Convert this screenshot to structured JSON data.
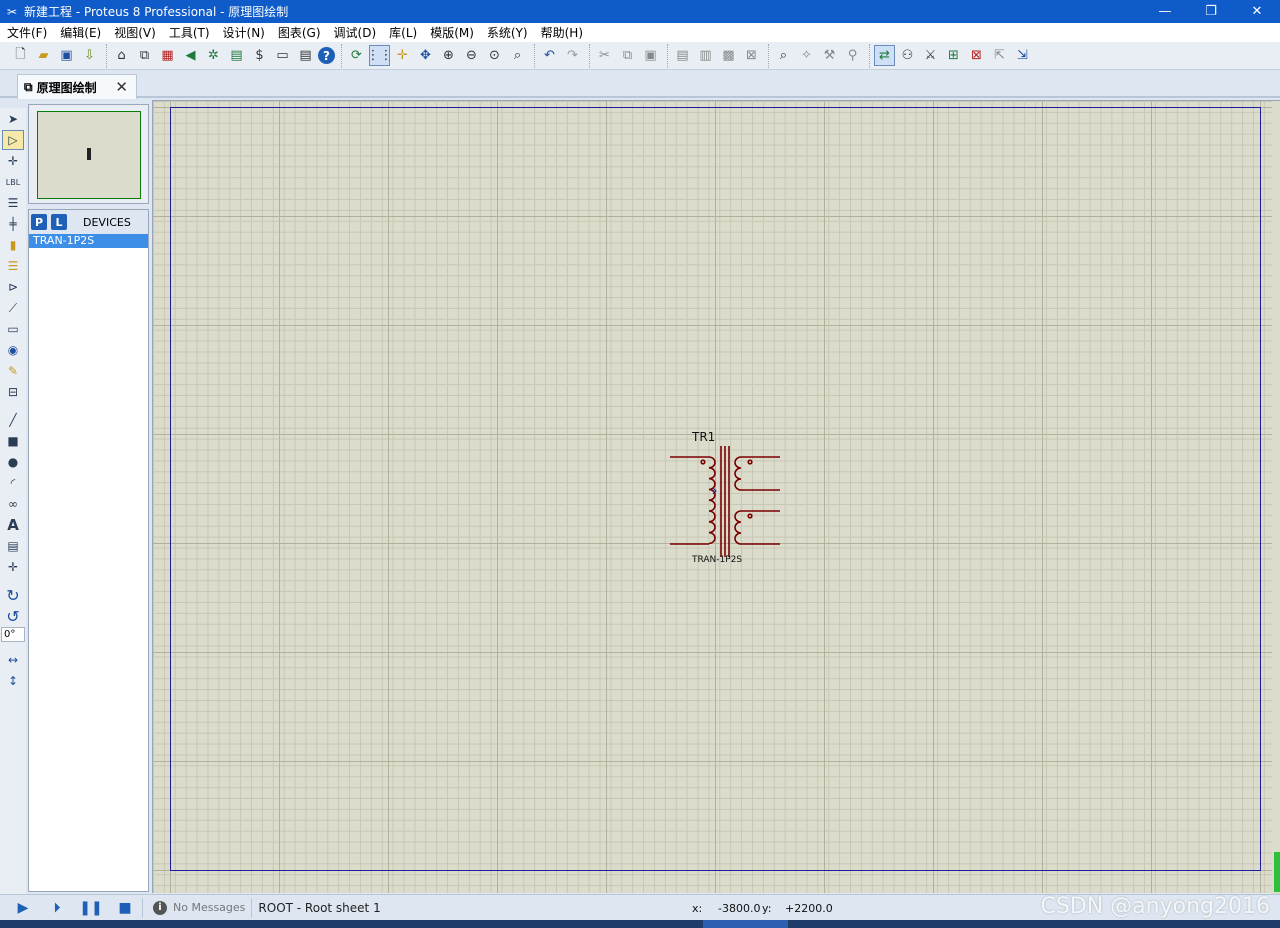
{
  "window": {
    "title": "新建工程 - Proteus 8 Professional - 原理图绘制",
    "controls": {
      "minimize": "—",
      "restore": "❐",
      "close": "✕"
    }
  },
  "menu": [
    "文件(F)",
    "编辑(E)",
    "视图(V)",
    "工具(T)",
    "设计(N)",
    "图表(G)",
    "调试(D)",
    "库(L)",
    "模版(M)",
    "系统(Y)",
    "帮助(H)"
  ],
  "tab": {
    "label": "原理图绘制",
    "close": "✕"
  },
  "toolbar_icons": {
    "file": [
      "new-icon",
      "open-icon",
      "save-icon",
      "import-icon"
    ],
    "panels": [
      "home-icon",
      "schematic-icon",
      "pcb-icon",
      "3d-icon",
      "gerber-icon",
      "bom-icon",
      "design-explorer-icon",
      "notes-icon",
      "help-icon"
    ],
    "view": [
      "refresh-icon",
      "grid-icon",
      "origin-icon",
      "pan-icon",
      "zoom-in-icon",
      "zoom-out-icon",
      "zoom-all-icon",
      "zoom-area-icon"
    ],
    "edit": [
      "undo-icon",
      "redo-icon",
      "cut-icon",
      "copy-icon",
      "paste-icon",
      "block-copy-icon",
      "block-move-icon",
      "block-rotate-icon",
      "block-delete-icon"
    ],
    "tools": [
      "pick-device-icon",
      "make-device-icon",
      "package-icon",
      "decompose-icon",
      "wire-autorouter-icon",
      "search-tag-icon",
      "property-assign-icon",
      "new-sheet-icon",
      "remove-sheet-icon",
      "exit-parent-icon",
      "netlist-icon"
    ]
  },
  "device_selector": {
    "p_label": "P",
    "l_label": "L",
    "title": "DEVICES",
    "items": [
      "TRAN-1P2S"
    ]
  },
  "rotation": {
    "angle": "0°"
  },
  "component": {
    "reference": "TR1",
    "value": "TRAN-1P2S"
  },
  "status": {
    "messages": "No Messages",
    "sheet": "ROOT - Root sheet 1",
    "x_label": "x:",
    "x_value": "-3800.0",
    "y_label": "y:",
    "y_value": "+2200.0"
  },
  "watermark": "CSDN @anyong2016"
}
